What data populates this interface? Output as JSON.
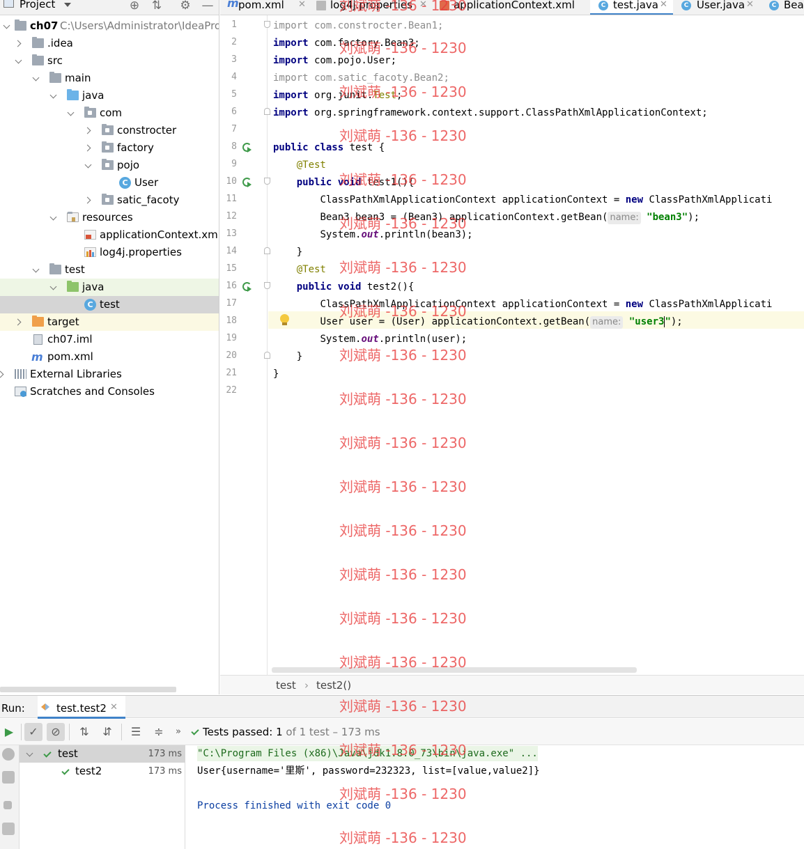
{
  "project_panel": {
    "title": "Project",
    "tree": [
      {
        "label": "ch07",
        "path": "C:\\Users\\Administrator\\IdeaPro"
      },
      {
        "label": ".idea"
      },
      {
        "label": "src"
      },
      {
        "label": "main"
      },
      {
        "label": "java"
      },
      {
        "label": "com"
      },
      {
        "label": "constrocter"
      },
      {
        "label": "factory"
      },
      {
        "label": "pojo"
      },
      {
        "label": "User"
      },
      {
        "label": "satic_facoty"
      },
      {
        "label": "resources"
      },
      {
        "label": "applicationContext.xml"
      },
      {
        "label": "log4j.properties"
      },
      {
        "label": "test"
      },
      {
        "label": "java"
      },
      {
        "label": "test"
      },
      {
        "label": "target"
      },
      {
        "label": "ch07.iml"
      },
      {
        "label": "pom.xml"
      },
      {
        "label": "External Libraries"
      },
      {
        "label": "Scratches and Consoles"
      }
    ]
  },
  "tabs": [
    {
      "label": "pom.xml",
      "icon": "maven-icon"
    },
    {
      "label": "log4j.properties",
      "icon": "properties-icon"
    },
    {
      "label": "applicationContext.xml",
      "icon": "xml-icon"
    },
    {
      "label": "test.java",
      "icon": "class-icon"
    },
    {
      "label": "User.java",
      "icon": "class-icon"
    },
    {
      "label": "Bea",
      "icon": "class-icon"
    }
  ],
  "editor": {
    "line_numbers": [
      "1",
      "2",
      "3",
      "4",
      "5",
      "6",
      "7",
      "8",
      "9",
      "10",
      "11",
      "12",
      "13",
      "14",
      "15",
      "16",
      "17",
      "18",
      "19",
      "20",
      "21",
      "22"
    ],
    "code": {
      "l1_kw": "import",
      "l1_rest": " com.constrocter.Bean1;",
      "l2_kw": "import",
      "l2_rest": " com.factory.Bean3;",
      "l3_kw": "import",
      "l3_rest": " com.pojo.User;",
      "l4_kw": "import",
      "l4_rest": " com.satic_facoty.Bean2;",
      "l5_kw": "import",
      "l5_a": " org.junit.",
      "l5_b": "Test",
      "l5_c": ";",
      "l6_kw": "import",
      "l6_rest": " org.springframework.context.support.ClassPathXmlApplicationContext;",
      "l8_kw1": "public",
      "l8_kw2": "class",
      "l8_rest": " test {",
      "l9_ann": "@Test",
      "l10_kw1": "public",
      "l10_kw2": "void",
      "l10_rest": " test1(){",
      "l11_a": "ClassPathXmlApplicationContext applicationContext = ",
      "l11_kw": "new",
      "l11_b": " ClassPathXmlApplicati",
      "l12_a": "Bean3 bean3 = (Bean3) applicationContext.getBean(",
      "l12_hint": "name:",
      "l12_str": "\"bean3\"",
      "l12_b": ");",
      "l13_a": "System.",
      "l13_fld": "out",
      "l13_b": ".println(bean3);",
      "l14": "}",
      "l15_ann": "@Test",
      "l16_kw1": "public",
      "l16_kw2": "void",
      "l16_rest": " test2(){",
      "l17_a": "ClassPathXmlApplicationContext applicationContext = ",
      "l17_kw": "new",
      "l17_b": " ClassPathXmlApplicati",
      "l18_a": "User user = (User) applicationContext.getBean(",
      "l18_hint": "name:",
      "l18_str1": "\"user3",
      "l18_str2": "\"",
      "l18_b": ");",
      "l19_a": "System.",
      "l19_fld": "out",
      "l19_b": ".println(user);",
      "l20": "}",
      "l21": "}"
    }
  },
  "breadcrumb": {
    "item1": "test",
    "sep": "›",
    "item2": "test2()"
  },
  "run": {
    "label": "Run:",
    "tab_label": "test.test2",
    "status_prefix": "Tests passed:",
    "status_count": "1",
    "status_rest": "of 1 test – 173 ms",
    "tree": [
      {
        "label": "test",
        "time": "173 ms"
      },
      {
        "label": "test2",
        "time": "173 ms"
      }
    ],
    "console": {
      "cmd": "\"C:\\Program Files (x86)\\Java\\jdk1.8.0_73\\bin\\java.exe\" ...",
      "out": "User{username='里斯', password=232323, list=[value,value2]}",
      "proc": "Process finished with exit code 0"
    }
  },
  "watermark": "刘斌萌 -136 - 1230",
  "colors": {
    "accent": "#4083c9",
    "keyword": "#000080",
    "string": "#008000",
    "annotation": "#808000",
    "pass": "#3d9a48",
    "watermark": "#e83c3c"
  }
}
